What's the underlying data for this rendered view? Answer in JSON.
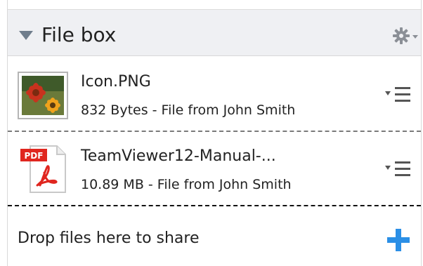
{
  "header": {
    "title": "File box",
    "collapse_icon": "triangle-down-icon",
    "settings_icon": "gear-icon"
  },
  "files": [
    {
      "name": "Icon.PNG",
      "meta": "832 Bytes - File from John Smith",
      "icon": "image-thumbnail-icon"
    },
    {
      "name": "TeamViewer12-Manual-...",
      "meta": "10.89 MB - File from John Smith",
      "icon": "pdf-file-icon",
      "badge": "PDF"
    }
  ],
  "drop_zone": {
    "label": "Drop files here to share",
    "add_icon": "plus-icon",
    "accent_color": "#2b8fe6"
  },
  "colors": {
    "header_bg": "#eff0f3",
    "pdf_red": "#e0261f"
  }
}
